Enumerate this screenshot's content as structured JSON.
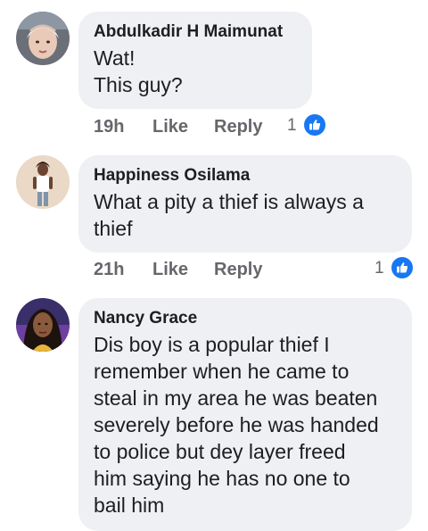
{
  "comments": [
    {
      "author": "Abdulkadir H Maimunat",
      "text": "Wat!\nThis guy?",
      "time": "19h",
      "like_label": "Like",
      "reply_label": "Reply",
      "reaction_count": "1",
      "reaction_icon": "thumbs-up-icon"
    },
    {
      "author": "Happiness Osilama",
      "text": "What a pity a thief is always a\nthief",
      "time": "21h",
      "like_label": "Like",
      "reply_label": "Reply",
      "reaction_count": "1",
      "reaction_icon": "thumbs-up-icon"
    },
    {
      "author": "Nancy Grace",
      "text": "Dis boy is a popular thief I\nremember when he came to\nsteal in my area he was beaten\nseverely before he was handed\nto police but dey layer freed\nhim saying he has no one to\nbail him"
    }
  ],
  "colors": {
    "bubble": "#eef0f3",
    "text": "#1c1e21",
    "meta": "#65676b",
    "like_blue": "#1877f2"
  }
}
